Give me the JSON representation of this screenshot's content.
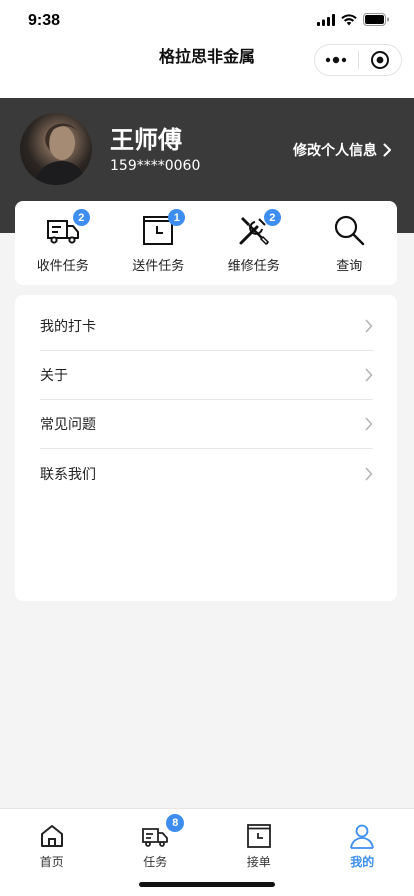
{
  "status_bar": {
    "time": "9:38"
  },
  "nav": {
    "title": "格拉思非金属"
  },
  "profile": {
    "name": "王师傅",
    "phone": "159****0060",
    "edit_label": "修改个人信息"
  },
  "tasks": [
    {
      "label": "收件任务",
      "icon": "truck-icon",
      "badge": "2"
    },
    {
      "label": "送件任务",
      "icon": "clock-box-icon",
      "badge": "1"
    },
    {
      "label": "维修任务",
      "icon": "tools-icon",
      "badge": "2"
    },
    {
      "label": "查询",
      "icon": "search-icon",
      "badge": ""
    }
  ],
  "menu": [
    {
      "label": "我的打卡"
    },
    {
      "label": "关于"
    },
    {
      "label": "常见问题"
    },
    {
      "label": "联系我们"
    }
  ],
  "tabbar": [
    {
      "label": "首页",
      "icon": "home-icon",
      "badge": ""
    },
    {
      "label": "任务",
      "icon": "truck-icon",
      "badge": "8"
    },
    {
      "label": "接单",
      "icon": "clock-box-icon",
      "badge": ""
    },
    {
      "label": "我的",
      "icon": "user-icon",
      "badge": "",
      "active": true
    }
  ],
  "colors": {
    "accent": "#3d8ef0",
    "header_bg": "#3a3a3a",
    "page_bg": "#f4f4f5"
  }
}
